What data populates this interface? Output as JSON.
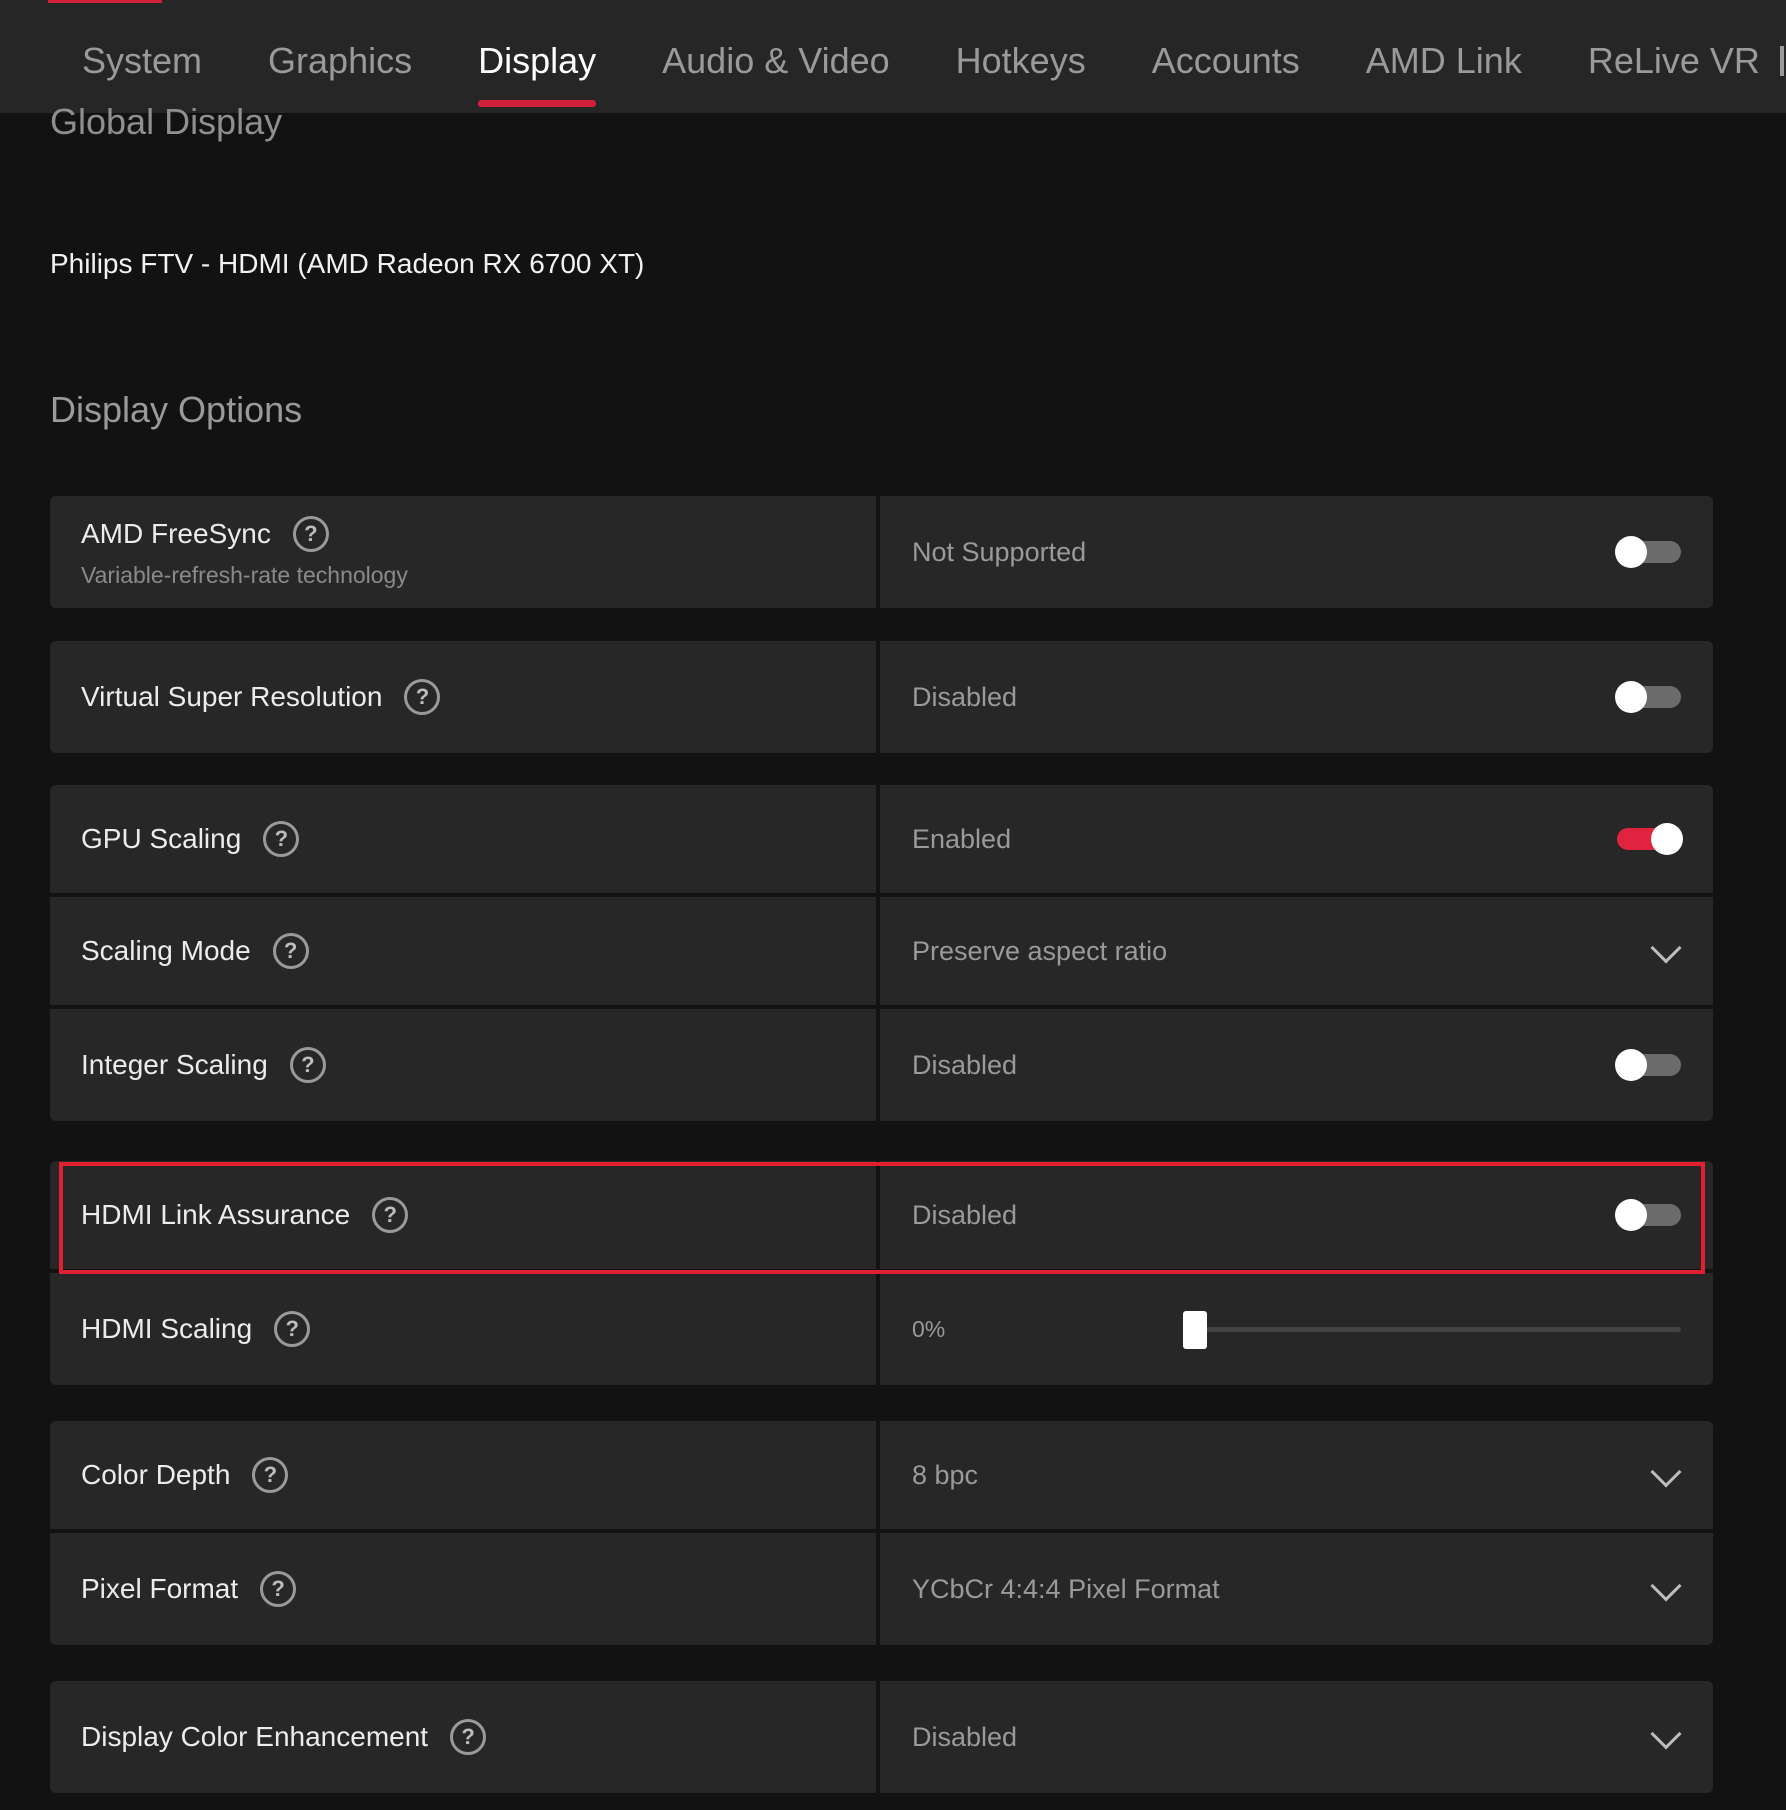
{
  "tabs": [
    {
      "label": "System"
    },
    {
      "label": "Graphics"
    },
    {
      "label": "Display"
    },
    {
      "label": "Audio & Video"
    },
    {
      "label": "Hotkeys"
    },
    {
      "label": "Accounts"
    },
    {
      "label": "AMD Link"
    },
    {
      "label": "ReLive VR"
    }
  ],
  "active_tab": "Display",
  "global_display": {
    "title": "Global Display",
    "display_name": "Philips FTV - HDMI (AMD Radeon RX 6700 XT)"
  },
  "display_options": {
    "title": "Display Options",
    "freesync": {
      "label": "AMD FreeSync",
      "sub": "Variable-refresh-rate technology",
      "value": "Not Supported",
      "toggle_on": false
    },
    "vsr": {
      "label": "Virtual Super Resolution",
      "value": "Disabled",
      "toggle_on": false
    },
    "gpu_scaling": {
      "label": "GPU Scaling",
      "value": "Enabled",
      "toggle_on": true
    },
    "scaling_mode": {
      "label": "Scaling Mode",
      "value": "Preserve aspect ratio"
    },
    "integer_scaling": {
      "label": "Integer Scaling",
      "value": "Disabled",
      "toggle_on": false
    },
    "hdmi_link": {
      "label": "HDMI Link Assurance",
      "value": "Disabled",
      "toggle_on": false
    },
    "hdmi_scaling": {
      "label": "HDMI Scaling",
      "value": "0%",
      "slider_fraction": 0
    },
    "color_depth": {
      "label": "Color Depth",
      "value": "8 bpc"
    },
    "pixel_format": {
      "label": "Pixel Format",
      "value": "YCbCr 4:4:4 Pixel Format"
    },
    "color_enhancement": {
      "label": "Display Color Enhancement",
      "value": "Disabled"
    }
  },
  "help_glyph": "?",
  "colors": {
    "accent": "#d1203a",
    "highlight": "#e02030",
    "panel": "#272727"
  }
}
